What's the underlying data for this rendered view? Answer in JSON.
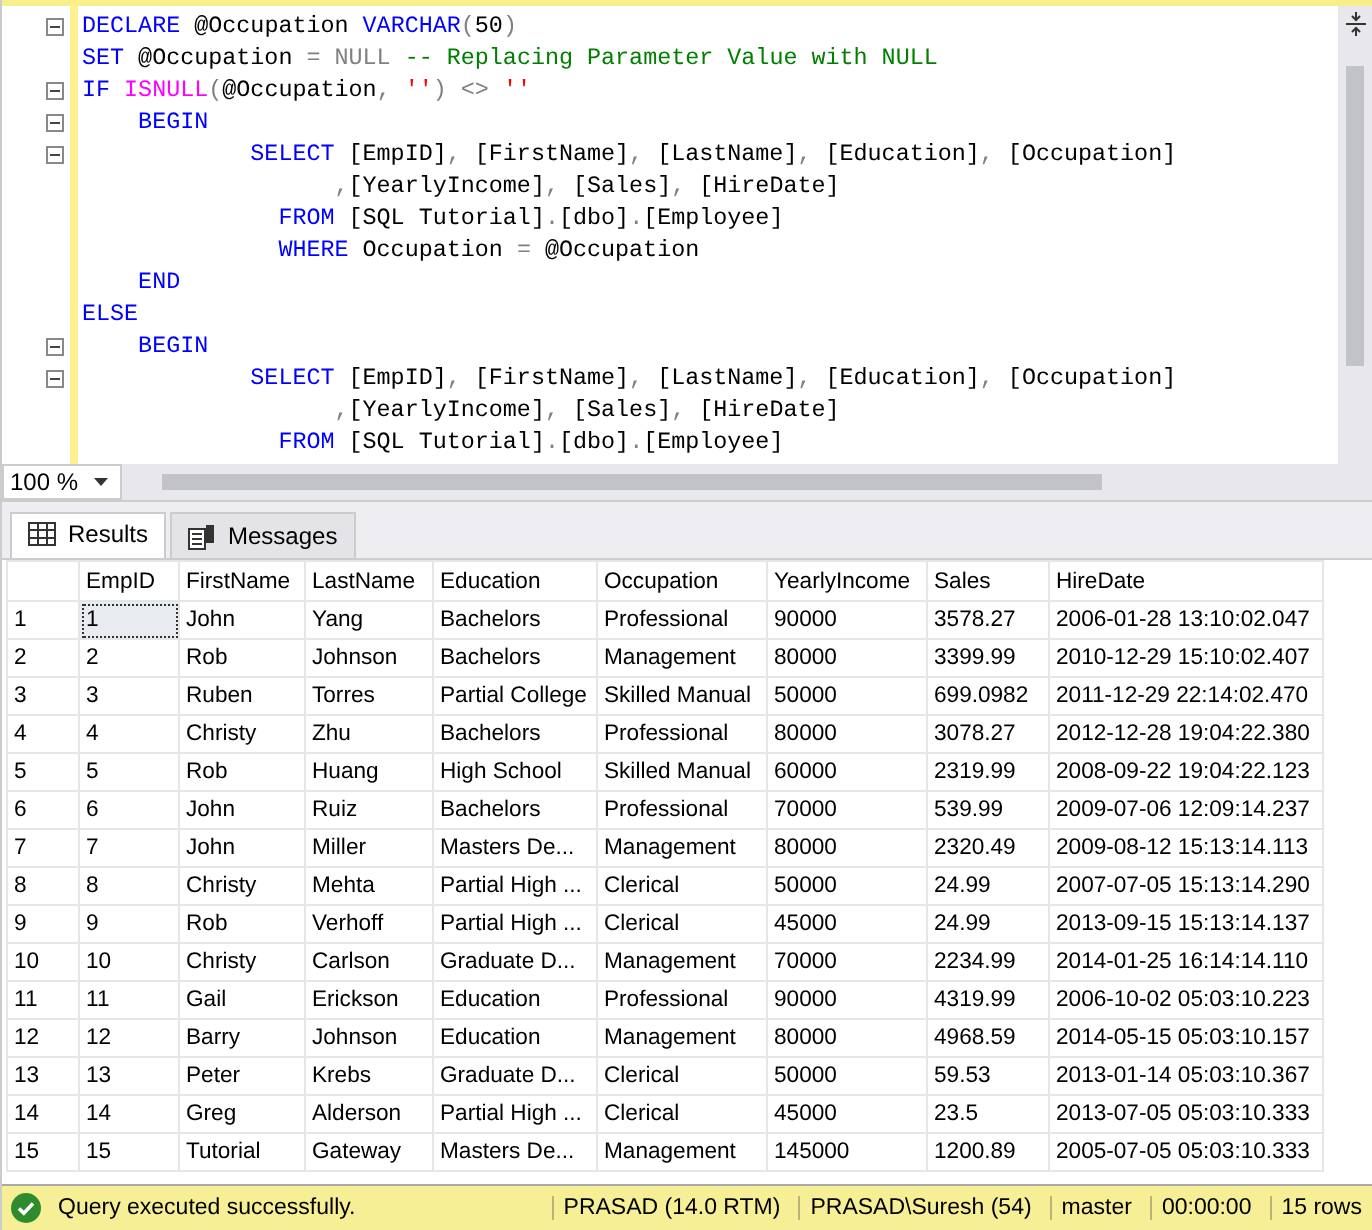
{
  "editor": {
    "lines": [
      {
        "fold": true,
        "tokens": [
          {
            "kind": "keyword",
            "text": "DECLARE"
          },
          {
            "kind": "plain",
            "text": " @Occupation "
          },
          {
            "kind": "keyword",
            "text": "VARCHAR"
          },
          {
            "kind": "operator",
            "text": "("
          },
          {
            "kind": "plain",
            "text": "50"
          },
          {
            "kind": "operator",
            "text": ")"
          }
        ]
      },
      {
        "fold": false,
        "tokens": [
          {
            "kind": "keyword",
            "text": "SET"
          },
          {
            "kind": "plain",
            "text": " @Occupation "
          },
          {
            "kind": "operator",
            "text": "= NULL"
          },
          {
            "kind": "comment",
            "text": " -- Replacing Parameter Value with NULL"
          }
        ]
      },
      {
        "fold": true,
        "tokens": [
          {
            "kind": "keyword",
            "text": "IF "
          },
          {
            "kind": "function",
            "text": "ISNULL"
          },
          {
            "kind": "operator",
            "text": "("
          },
          {
            "kind": "plain",
            "text": "@Occupation"
          },
          {
            "kind": "operator",
            "text": ","
          },
          {
            "kind": "string",
            "text": " ''"
          },
          {
            "kind": "operator",
            "text": ") <> "
          },
          {
            "kind": "string",
            "text": "''"
          }
        ]
      },
      {
        "fold": true,
        "tokens": [
          {
            "kind": "keyword",
            "text": "    BEGIN"
          }
        ]
      },
      {
        "fold": true,
        "tokens": [
          {
            "kind": "keyword",
            "text": "            SELECT"
          },
          {
            "kind": "plain",
            "text": " [EmpID]"
          },
          {
            "kind": "operator",
            "text": ","
          },
          {
            "kind": "plain",
            "text": " [FirstName]"
          },
          {
            "kind": "operator",
            "text": ","
          },
          {
            "kind": "plain",
            "text": " [LastName]"
          },
          {
            "kind": "operator",
            "text": ","
          },
          {
            "kind": "plain",
            "text": " [Education]"
          },
          {
            "kind": "operator",
            "text": ","
          },
          {
            "kind": "plain",
            "text": " [Occupation]"
          }
        ]
      },
      {
        "fold": false,
        "tokens": [
          {
            "kind": "operator",
            "text": "                  ,"
          },
          {
            "kind": "plain",
            "text": "[YearlyIncome]"
          },
          {
            "kind": "operator",
            "text": ","
          },
          {
            "kind": "plain",
            "text": " [Sales]"
          },
          {
            "kind": "operator",
            "text": ","
          },
          {
            "kind": "plain",
            "text": " [HireDate]"
          }
        ]
      },
      {
        "fold": false,
        "tokens": [
          {
            "kind": "keyword",
            "text": "              FROM"
          },
          {
            "kind": "plain",
            "text": " [SQL Tutorial]"
          },
          {
            "kind": "operator",
            "text": "."
          },
          {
            "kind": "plain",
            "text": "[dbo]"
          },
          {
            "kind": "operator",
            "text": "."
          },
          {
            "kind": "plain",
            "text": "[Employee]"
          }
        ]
      },
      {
        "fold": false,
        "tokens": [
          {
            "kind": "keyword",
            "text": "              WHERE"
          },
          {
            "kind": "plain",
            "text": " Occupation "
          },
          {
            "kind": "operator",
            "text": "="
          },
          {
            "kind": "plain",
            "text": " @Occupation"
          }
        ]
      },
      {
        "fold": false,
        "tokens": [
          {
            "kind": "keyword",
            "text": "    END"
          }
        ]
      },
      {
        "fold": false,
        "tokens": [
          {
            "kind": "keyword",
            "text": "ELSE"
          }
        ]
      },
      {
        "fold": true,
        "tokens": [
          {
            "kind": "keyword",
            "text": "    BEGIN"
          }
        ]
      },
      {
        "fold": true,
        "tokens": [
          {
            "kind": "keyword",
            "text": "            SELECT"
          },
          {
            "kind": "plain",
            "text": " [EmpID]"
          },
          {
            "kind": "operator",
            "text": ","
          },
          {
            "kind": "plain",
            "text": " [FirstName]"
          },
          {
            "kind": "operator",
            "text": ","
          },
          {
            "kind": "plain",
            "text": " [LastName]"
          },
          {
            "kind": "operator",
            "text": ","
          },
          {
            "kind": "plain",
            "text": " [Education]"
          },
          {
            "kind": "operator",
            "text": ","
          },
          {
            "kind": "plain",
            "text": " [Occupation]"
          }
        ]
      },
      {
        "fold": false,
        "tokens": [
          {
            "kind": "operator",
            "text": "                  ,"
          },
          {
            "kind": "plain",
            "text": "[YearlyIncome]"
          },
          {
            "kind": "operator",
            "text": ","
          },
          {
            "kind": "plain",
            "text": " [Sales]"
          },
          {
            "kind": "operator",
            "text": ","
          },
          {
            "kind": "plain",
            "text": " [HireDate]"
          }
        ]
      },
      {
        "fold": false,
        "tokens": [
          {
            "kind": "keyword",
            "text": "              FROM"
          },
          {
            "kind": "plain",
            "text": " [SQL Tutorial]"
          },
          {
            "kind": "operator",
            "text": "."
          },
          {
            "kind": "plain",
            "text": "[dbo]"
          },
          {
            "kind": "operator",
            "text": "."
          },
          {
            "kind": "plain",
            "text": "[Employee]"
          }
        ]
      }
    ],
    "zoom": "100 %"
  },
  "tabs": [
    {
      "label": "Results",
      "selected": true
    },
    {
      "label": "Messages",
      "selected": false
    }
  ],
  "table": {
    "columns": [
      "EmpID",
      "FirstName",
      "LastName",
      "Education",
      "Occupation",
      "YearlyIncome",
      "Sales",
      "HireDate"
    ],
    "rows": [
      {
        "number": "1",
        "selected": true,
        "cells": [
          "1",
          "John",
          "Yang",
          "Bachelors",
          "Professional",
          "90000",
          "3578.27",
          "2006-01-28 13:10:02.047"
        ]
      },
      {
        "number": "2",
        "selected": false,
        "cells": [
          "2",
          "Rob",
          "Johnson",
          "Bachelors",
          "Management",
          "80000",
          "3399.99",
          "2010-12-29 15:10:02.407"
        ]
      },
      {
        "number": "3",
        "selected": false,
        "cells": [
          "3",
          "Ruben",
          "Torres",
          "Partial College",
          "Skilled Manual",
          "50000",
          "699.0982",
          "2011-12-29 22:14:02.470"
        ]
      },
      {
        "number": "4",
        "selected": false,
        "cells": [
          "4",
          "Christy",
          "Zhu",
          "Bachelors",
          "Professional",
          "80000",
          "3078.27",
          "2012-12-28 19:04:22.380"
        ]
      },
      {
        "number": "5",
        "selected": false,
        "cells": [
          "5",
          "Rob",
          "Huang",
          "High School",
          "Skilled Manual",
          "60000",
          "2319.99",
          "2008-09-22 19:04:22.123"
        ]
      },
      {
        "number": "6",
        "selected": false,
        "cells": [
          "6",
          "John",
          "Ruiz",
          "Bachelors",
          "Professional",
          "70000",
          "539.99",
          "2009-07-06 12:09:14.237"
        ]
      },
      {
        "number": "7",
        "selected": false,
        "cells": [
          "7",
          "John",
          "Miller",
          "Masters De...",
          "Management",
          "80000",
          "2320.49",
          "2009-08-12 15:13:14.113"
        ]
      },
      {
        "number": "8",
        "selected": false,
        "cells": [
          "8",
          "Christy",
          "Mehta",
          "Partial High ...",
          "Clerical",
          "50000",
          "24.99",
          "2007-07-05 15:13:14.290"
        ]
      },
      {
        "number": "9",
        "selected": false,
        "cells": [
          "9",
          "Rob",
          "Verhoff",
          "Partial High ...",
          "Clerical",
          "45000",
          "24.99",
          "2013-09-15 15:13:14.137"
        ]
      },
      {
        "number": "10",
        "selected": false,
        "cells": [
          "10",
          "Christy",
          "Carlson",
          "Graduate D...",
          "Management",
          "70000",
          "2234.99",
          "2014-01-25 16:14:14.110"
        ]
      },
      {
        "number": "11",
        "selected": false,
        "cells": [
          "11",
          "Gail",
          "Erickson",
          "Education",
          "Professional",
          "90000",
          "4319.99",
          "2006-10-02 05:03:10.223"
        ]
      },
      {
        "number": "12",
        "selected": false,
        "cells": [
          "12",
          "Barry",
          "Johnson",
          "Education",
          "Management",
          "80000",
          "4968.59",
          "2014-05-15 05:03:10.157"
        ]
      },
      {
        "number": "13",
        "selected": false,
        "cells": [
          "13",
          "Peter",
          "Krebs",
          "Graduate D...",
          "Clerical",
          "50000",
          "59.53",
          "2013-01-14 05:03:10.367"
        ]
      },
      {
        "number": "14",
        "selected": false,
        "cells": [
          "14",
          "Greg",
          "Alderson",
          "Partial High ...",
          "Clerical",
          "45000",
          "23.5",
          "2013-07-05 05:03:10.333"
        ]
      },
      {
        "number": "15",
        "selected": false,
        "cells": [
          "15",
          "Tutorial",
          "Gateway",
          "Masters De...",
          "Management",
          "145000",
          "1200.89",
          "2005-07-05 05:03:10.333"
        ]
      }
    ]
  },
  "status_bar": {
    "message": "Query executed successfully.",
    "server": "PRASAD (14.0 RTM)",
    "user": "PRASAD\\Suresh (54)",
    "database": "master",
    "elapsed": "00:00:00",
    "rows": "15 rows"
  }
}
